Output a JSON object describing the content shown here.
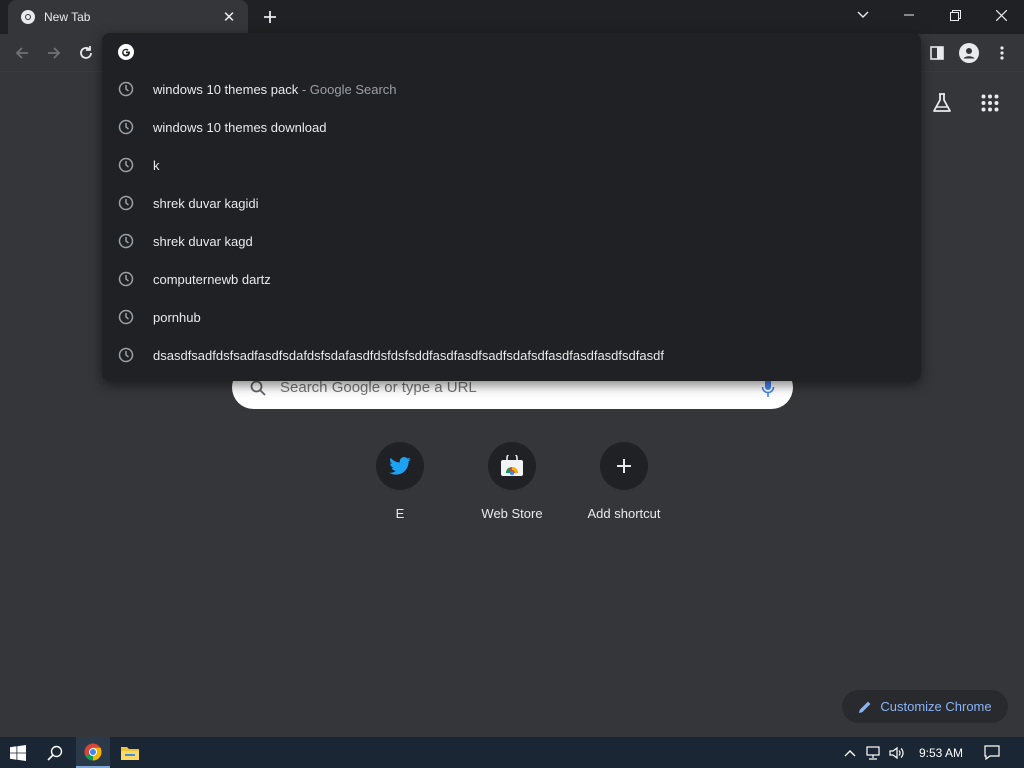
{
  "browser": {
    "tab": {
      "title": "New Tab"
    },
    "colors": {
      "frame": "#202124",
      "toolbar": "#35363a",
      "accent": "#8ab4f8"
    }
  },
  "omnibox": {
    "value": "",
    "suggestions": [
      {
        "text": "windows 10 themes pack",
        "description": " - Google Search"
      },
      {
        "text": "windows 10 themes download",
        "description": ""
      },
      {
        "text": "k",
        "description": ""
      },
      {
        "text": "shrek duvar kagidi",
        "description": ""
      },
      {
        "text": "shrek duvar kagd",
        "description": ""
      },
      {
        "text": "computernewb dartz",
        "description": ""
      },
      {
        "text": "pornhub",
        "description": ""
      },
      {
        "text": "dsasdfsadfdsfsadfasdfsdafdsfsdafasdfdsfdsfsddfasdfasdfsadfsdafsdfasdfasdfasdfsdfasdf",
        "description": ""
      }
    ]
  },
  "ntp": {
    "search_placeholder": "Search Google or type a URL",
    "shortcuts": [
      {
        "label": "E",
        "icon": "twitter-icon"
      },
      {
        "label": "Web Store",
        "icon": "web-store-icon"
      },
      {
        "label": "Add shortcut",
        "icon": "plus-icon"
      }
    ],
    "customize_label": "Customize Chrome"
  },
  "taskbar": {
    "time": "9:53 AM"
  }
}
